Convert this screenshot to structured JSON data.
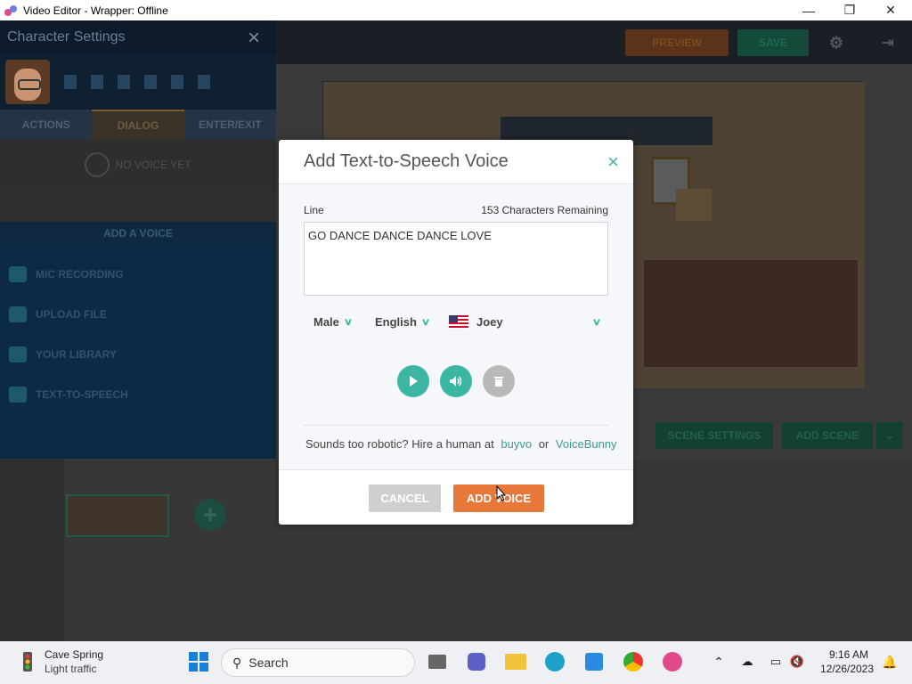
{
  "window": {
    "title": "Video Editor - Wrapper: Offline",
    "minimize": "—",
    "maximize": "❐",
    "close": "✕"
  },
  "left_panel": {
    "title": "Character Settings",
    "tabs": [
      "ACTIONS",
      "DIALOG",
      "ENTER/EXIT"
    ],
    "no_voice": "NO VOICE YET",
    "add_a_voice": "ADD A VOICE",
    "menu": [
      "MIC RECORDING",
      "UPLOAD FILE",
      "YOUR LIBRARY",
      "TEXT-TO-SPEECH"
    ]
  },
  "toolbar": {
    "preview": "PREVIEW",
    "save": "SAVE"
  },
  "scene_buttons": {
    "scene_settings": "SCENE SETTINGS",
    "add_scene": "ADD SCENE"
  },
  "modal": {
    "title": "Add Text-to-Speech Voice",
    "close": "×",
    "line_label": "Line",
    "remaining": "153 Characters Remaining",
    "text": "GO  DANCE DANCE DANCE LOVE",
    "gender": "Male",
    "language": "English",
    "voice": "Joey",
    "robot_text": "Sounds too robotic? Hire a human at",
    "link1": "buyvo",
    "or": "or",
    "link2": "VoiceBunny",
    "cancel": "CANCEL",
    "add_voice": "ADD VOICE"
  },
  "taskbar": {
    "weather_title": "Cave Spring",
    "weather_sub": "Light traffic",
    "search": "Search",
    "time": "9:16 AM",
    "date": "12/26/2023"
  },
  "colors": {
    "accent_green": "#3bb6a2",
    "accent_orange": "#e8773a"
  }
}
